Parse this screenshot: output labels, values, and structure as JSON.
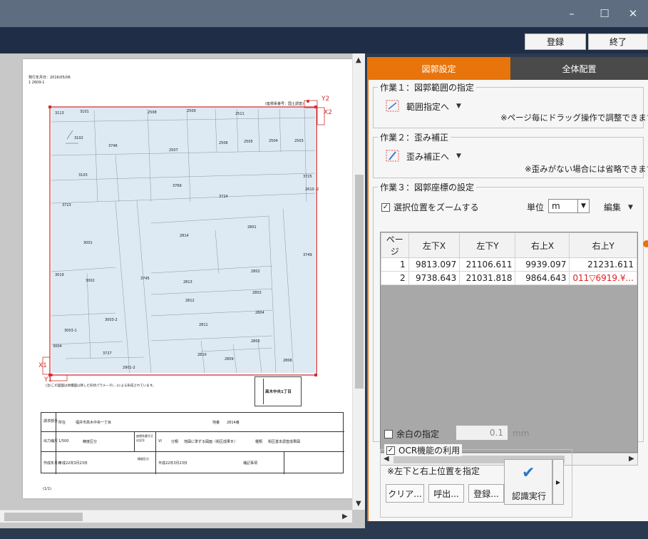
{
  "window": {
    "minimize": "–",
    "maximize": "☐",
    "close": "✕"
  },
  "toolbar": {
    "register_label": "登録",
    "exit_label": "終了"
  },
  "document": {
    "header_date": "発行年月日：2016/05/06",
    "header_code": "1 2609-1",
    "scale_note_top": "(座標系番号：国土調査)",
    "corner_labels": [
      "Y2",
      "X2",
      "Y1",
      "X1"
    ],
    "parcels": [
      "3113",
      "3101",
      "2508",
      "2509",
      "2511",
      "3102",
      "3746",
      "2507",
      "2506",
      "2505",
      "2504",
      "2503",
      "3103",
      "3769",
      "3725",
      "3724",
      "2610 -2",
      "3723",
      "2814",
      "2801",
      "3001",
      "3749",
      "3019",
      "3002",
      "3745",
      "2813",
      "2802",
      "2803",
      "2812",
      "2804",
      "3003-2",
      "2811",
      "3003-1",
      "2805",
      "3727",
      "2810",
      "2809",
      "2806",
      "2901-2",
      "3004"
    ],
    "footer_note": "(注)この図面は地積図以降した形状パラメータ(...)による形成されています。",
    "stamp_label": "高木中央1丁目",
    "table": {
      "row1": {
        "l1": "請求部分",
        "l2": "所在",
        "v2": "福井市高木中央一丁目",
        "l3": "地番",
        "v3": "2814番"
      },
      "row2": {
        "l1": "出力縮尺",
        "v1": "1/500",
        "l2": "精度区分",
        "l3": "座標系番号又は記号",
        "v3": "VI",
        "l4": "分類",
        "v4": "地図に準ずる図面（街区成果Ｂ）",
        "l5": "種類",
        "v5": "街区基本調査成果図"
      },
      "row3": {
        "l1": "作成年月日",
        "v1": "平成22年3月23日",
        "l2": "備付年月日(原図)",
        "v2": "平成22年3月23日",
        "l3": "補記事項"
      }
    },
    "page_num": "(1/1)"
  },
  "tabs": {
    "active": "図郭設定",
    "inactive": "全体配置"
  },
  "task1": {
    "legend": "作業１：図郭範囲の指定",
    "button": "範囲指定へ",
    "note": "※ページ毎にドラッグ操作で調整できます"
  },
  "task2": {
    "legend": "作業２：歪み補正",
    "button": "歪み補正へ",
    "note": "※歪みがない場合には省略できます"
  },
  "task3": {
    "legend": "作業３：図郭座標の設定",
    "zoom_label": "選択位置をズームする",
    "unit_label": "単位",
    "unit_value": "m",
    "edit_label": "編集",
    "columns": [
      "ページ",
      "左下X",
      "左下Y",
      "右上X",
      "右上Y"
    ],
    "rows": [
      [
        "1",
        "9813.097",
        "21106.611",
        "9939.097",
        "21231.611"
      ],
      [
        "2",
        "9738.643",
        "21031.818",
        "9864.643",
        "011▽6919.¥..."
      ]
    ]
  },
  "margin": {
    "label": "余白の指定",
    "value": "0.1",
    "unit": "mm"
  },
  "ocr": {
    "legend": "OCR機能の利用",
    "note": "※左下と右上位置を指定",
    "clear": "クリア...",
    "call": "呼出...",
    "register": "登録...",
    "run": "認識実行"
  },
  "colors": {
    "accent": "#e8740c",
    "error_text": "#e02020",
    "frame_red": "#d23030"
  }
}
